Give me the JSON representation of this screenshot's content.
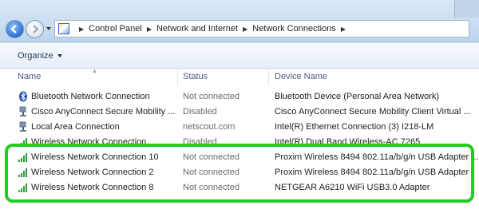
{
  "address": {
    "crumbs": [
      "Control Panel",
      "Network and Internet",
      "Network Connections"
    ]
  },
  "toolbar": {
    "organize_label": "Organize"
  },
  "columns": {
    "name": "Name",
    "status": "Status",
    "device": "Device Name"
  },
  "rows": [
    {
      "name": "Bluetooth Network Connection",
      "status": "Not connected",
      "device": "Bluetooth Device (Personal Area Network)",
      "icon": "bluetooth-icon"
    },
    {
      "name": "Cisco AnyConnect Secure Mobility ...",
      "status": "Disabled",
      "device": "Cisco AnyConnect Secure Mobility Client Virtual ...",
      "icon": "ethernet-icon"
    },
    {
      "name": "Local Area Connection",
      "status": "netscout.com",
      "device": "Intel(R) Ethernet Connection (3) I218-LM",
      "icon": "ethernet-icon"
    },
    {
      "name": "Wireless Network Connection",
      "status": "Disabled",
      "device": "Intel(R) Dual Band Wireless-AC 7265",
      "icon": "wireless-signal-icon"
    },
    {
      "name": "Wireless Network Connection 10",
      "status": "Not connected",
      "device": "Proxim Wireless 8494 802.11a/b/g/n USB Adapter ...",
      "icon": "wireless-signal-icon"
    },
    {
      "name": "Wireless Network Connection 2",
      "status": "Not connected",
      "device": "Proxim Wireless 8494 802.11a/b/g/n USB Adapter",
      "icon": "wireless-signal-icon"
    },
    {
      "name": "Wireless Network Connection 8",
      "status": "Not connected",
      "device": "NETGEAR A6210 WiFi USB3.0 Adapter",
      "icon": "wireless-signal-icon"
    }
  ],
  "colors": {
    "highlight": "#22cc22",
    "accent": "#2a6fd1"
  }
}
